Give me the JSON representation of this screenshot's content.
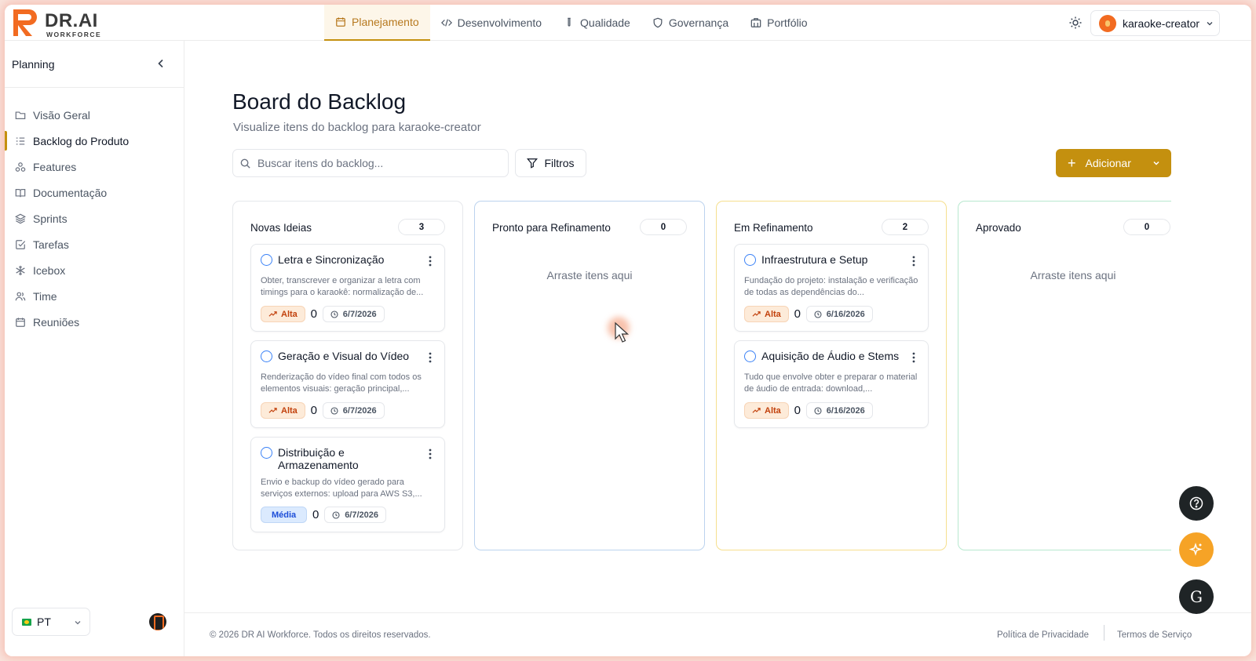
{
  "brand": {
    "name": "DR.AI",
    "sub": "WORKFORCE"
  },
  "nav": {
    "items": [
      {
        "label": "Planejamento",
        "icon": "calendar-icon"
      },
      {
        "label": "Desenvolvimento",
        "icon": "code-icon"
      },
      {
        "label": "Qualidade",
        "icon": "test-tube-icon"
      },
      {
        "label": "Governança",
        "icon": "shield-icon"
      },
      {
        "label": "Portfólio",
        "icon": "building-icon"
      }
    ],
    "active": "Planejamento"
  },
  "user": {
    "project": "karaoke-creator"
  },
  "sidebar": {
    "title": "Planning",
    "items": [
      {
        "label": "Visão Geral",
        "icon": "folder-icon"
      },
      {
        "label": "Backlog do Produto",
        "icon": "list-icon"
      },
      {
        "label": "Features",
        "icon": "shapes-icon"
      },
      {
        "label": "Documentação",
        "icon": "book-icon"
      },
      {
        "label": "Sprints",
        "icon": "layers-icon"
      },
      {
        "label": "Tarefas",
        "icon": "check-square-icon"
      },
      {
        "label": "Icebox",
        "icon": "snowflake-icon"
      },
      {
        "label": "Time",
        "icon": "users-icon"
      },
      {
        "label": "Reuniões",
        "icon": "calendar-icon"
      }
    ],
    "active": "Backlog do Produto",
    "language": "PT"
  },
  "page": {
    "title": "Board do Backlog",
    "subtitle": "Visualize itens do backlog para karaoke-creator",
    "search_placeholder": "Buscar itens do backlog...",
    "filters_label": "Filtros",
    "add_label": "Adicionar"
  },
  "columns": [
    {
      "title": "Novas Ideias",
      "count": "3",
      "cards": [
        {
          "title": "Letra e Sincronização",
          "desc": "Obter, transcrever e organizar a letra com timings para o karaokê: normalização de...",
          "priority": "Alta",
          "points": "0",
          "date": "6/7/2026"
        },
        {
          "title": "Geração e Visual do Vídeo",
          "desc": "Renderização do vídeo final com todos os elementos visuais: geração principal,...",
          "priority": "Alta",
          "points": "0",
          "date": "6/7/2026"
        },
        {
          "title": "Distribuição e Armazenamento",
          "desc": "Envio e backup do vídeo gerado para serviços externos: upload para AWS S3,...",
          "priority": "Média",
          "points": "0",
          "date": "6/7/2026"
        }
      ]
    },
    {
      "title": "Pronto para Refinamento",
      "count": "0",
      "empty": "Arraste itens aqui",
      "cards": []
    },
    {
      "title": "Em Refinamento",
      "count": "2",
      "cards": [
        {
          "title": "Infraestrutura e Setup",
          "desc": "Fundação do projeto: instalação e verificação de todas as dependências do...",
          "priority": "Alta",
          "points": "0",
          "date": "6/16/2026"
        },
        {
          "title": "Aquisição de Áudio e Stems",
          "desc": "Tudo que envolve obter e preparar o material de áudio de entrada: download,...",
          "priority": "Alta",
          "points": "0",
          "date": "6/16/2026"
        }
      ]
    },
    {
      "title": "Aprovado",
      "count": "0",
      "empty": "Arraste itens aqui",
      "cards": []
    }
  ],
  "footer": {
    "copyright": "© 2026 DR AI Workforce. Todos os direitos reservados.",
    "privacy": "Política de Privacidade",
    "terms": "Termos de Serviço"
  },
  "colors": {
    "accent": "#c4900f",
    "alta": "#c2410c",
    "media": "#1d4ed8",
    "ai_fab": "#f6a326"
  },
  "fabs": {
    "g_label": "G"
  }
}
